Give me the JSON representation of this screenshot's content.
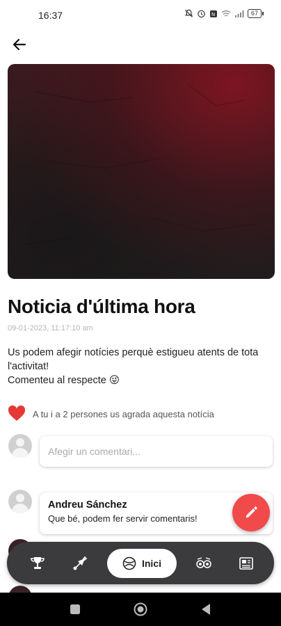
{
  "status_bar": {
    "time": "16:37",
    "battery": "67"
  },
  "article": {
    "title": "Noticia d'última hora",
    "date": "09-01-2023, 11:17:10 am",
    "body_line_1": "Us podem afegir notícies perquè estigueu atents de tota l'activitat!",
    "body_line_2": "Comenteu al respecte 😜"
  },
  "likes": {
    "text": "A tu i a 2 persones us agrada aquesta notícia"
  },
  "comment_input": {
    "placeholder": "Afegir un comentari..."
  },
  "comments": [
    {
      "author": "Andreu Sánchez",
      "text": "Que bé, podem fer servir comentaris!"
    }
  ],
  "bottom_nav": {
    "home_label": "Inici"
  },
  "colors": {
    "accent": "#f04a4a",
    "nav_bg": "#3b3b3d",
    "heart": "#e53935"
  }
}
